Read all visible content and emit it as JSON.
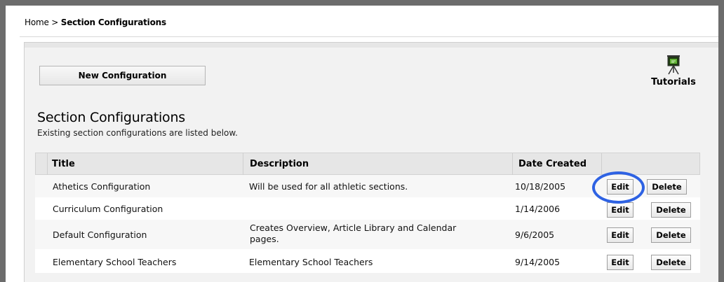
{
  "breadcrumb": {
    "home": "Home",
    "separator": ">",
    "current": "Section Configurations"
  },
  "toolbar": {
    "new_config_label": "New Configuration",
    "tutorials_label": "Tutorials"
  },
  "section": {
    "title": "Section Configurations",
    "subtitle": "Existing section configurations are listed below."
  },
  "table": {
    "columns": [
      "Title",
      "Description",
      "Date Created"
    ],
    "rows": [
      {
        "title": "Athetics Configuration",
        "description_line1": "Will be used for all athletic sections.",
        "description_line2": "",
        "date": "10/18/2005",
        "edit": "Edit",
        "delete": "Delete"
      },
      {
        "title": "Curriculum Configuration",
        "description_line1": "",
        "description_line2": "",
        "date": "1/14/2006",
        "edit": "Edit",
        "delete": "Delete"
      },
      {
        "title": "Default Configuration",
        "description_line1": "Creates Overview, Article Library and Calendar",
        "description_line2": "pages.",
        "date": "9/6/2005",
        "edit": "Edit",
        "delete": "Delete"
      },
      {
        "title": "Elementary School Teachers",
        "description_line1": "Elementary School Teachers",
        "description_line2": "",
        "date": "9/14/2005",
        "edit": "Edit",
        "delete": "Delete"
      }
    ]
  },
  "colors": {
    "frame": "#6c6c6c",
    "panel": "#f2f2f2",
    "header": "#e6e6e6",
    "highlight": "#2e62e3"
  },
  "icons": {
    "tutorials": "presentation-board-icon"
  }
}
